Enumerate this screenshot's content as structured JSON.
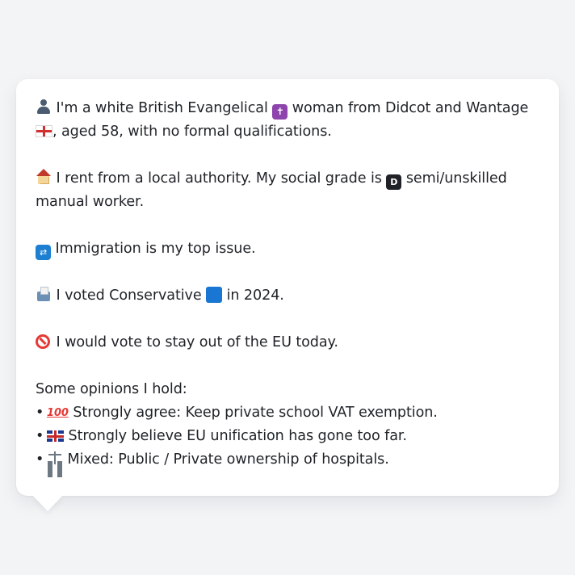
{
  "persona": {
    "line1_part_a": "I'm a white British Evangelical",
    "line1_part_b": "woman from Didcot and Wantage",
    "line1_part_c": ",",
    "line1_part_d": "aged 58, with no formal qualifications.",
    "line2_part_a": "I rent from a local authority. My social grade is",
    "line2_part_b": "semi/unskilled manual worker.",
    "line3": "Immigration is my top issue.",
    "line4_part_a": "I voted Conservative",
    "line4_part_b": "in 2024.",
    "line5": "I would vote to stay out of the EU today.",
    "opinions_heading": "Some opinions I hold:",
    "opinions": [
      "Strongly agree: Keep private school VAT exemption.",
      "Strongly believe EU unification has gone too far.",
      "Mixed: Public / Private ownership of hospitals."
    ]
  },
  "glyphs": {
    "cross": "✝",
    "grade_letter": "D",
    "border_arrows": "⇄",
    "hundred": "100",
    "bullet": "•"
  },
  "colors": {
    "background": "#f3f4f6",
    "bubble": "#ffffff",
    "text": "#1f2328",
    "conservative_blue": "#1976d2",
    "cross_purple": "#8e44ad"
  }
}
